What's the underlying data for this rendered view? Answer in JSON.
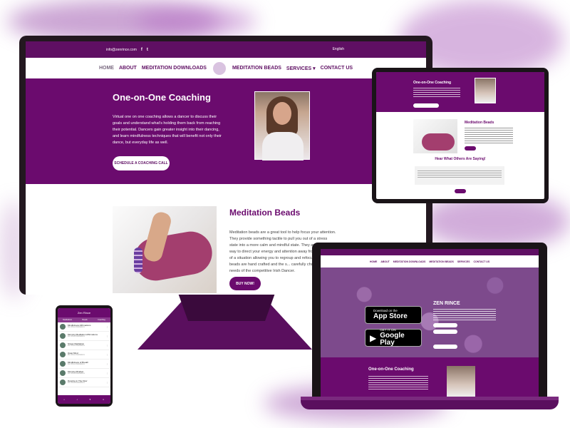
{
  "desktop": {
    "topbar": {
      "email": "info@zenrince.com",
      "social": [
        "f",
        "t"
      ],
      "language": "English"
    },
    "nav": [
      "HOME",
      "ABOUT",
      "MEDITATION DOWNLOADS",
      "MEDITATION BEADS",
      "SERVICES",
      "CONTACT US"
    ],
    "hero": {
      "title": "One-on-One Coaching",
      "text": "Virtual one on one coaching allows a dancer to discuss their goals and understand what's holding them back from reaching their potential. Dancers gain greater insight into their dancing, and learn mindfulness techniques that will benefit not only their dance, but everyday life as well.",
      "button": "SCHEDULE A COACHING CALL"
    },
    "beads": {
      "title": "Meditation Beads",
      "text": "Meditation beads are a great tool to help focus your attention. They provide something tactile to pull you out of a stress state into a more calm and mindful state.  They are a physical way to direct your energy and attention away from the stress of a situation allowing you to regroup and refocus. These beads are hand crafted and the s... carefully chosen for the needs of the competitive Irish Dancer.",
      "button": "BUY NOW!"
    }
  },
  "tablet": {
    "hero_title": "One-on-One Coaching",
    "beads_title": "Meditation Beads",
    "testimonials_title": "Hear What Others Are Saying!"
  },
  "laptop": {
    "nav": [
      "HOME",
      "ABOUT",
      "MEDITATION DOWNLOADS",
      "MEDITATION BEADS",
      "SERVICES",
      "CONTACT US"
    ],
    "app_store": {
      "small": "Download on the",
      "big": "App Store"
    },
    "google_play": {
      "small": "GET IT ON",
      "big": "Google Play"
    },
    "hero_title": "ZEN RINCE",
    "coaching_title": "One-on-One Coaching"
  },
  "phone": {
    "header": "Zen Rince",
    "tabs": [
      "Meditations",
      "Beads",
      "Coaching"
    ],
    "items": [
      {
        "title": "Mindfulness Affirmations",
        "sub": "Zen Rince Meditations"
      },
      {
        "title": "Morning Meditation Affirmations",
        "sub": "Zen Rince Meditations"
      },
      {
        "title": "Stress Meditation",
        "sub": "Zen Rince Meditations"
      },
      {
        "title": "Quiet Mind",
        "sub": "Zen Rince Meditations"
      },
      {
        "title": "Mindfulness of Breath",
        "sub": "Zen Rince Meditations"
      },
      {
        "title": "Morning Mindset",
        "sub": "Zen Rince Meditations"
      },
      {
        "title": "Dancing in The Flow",
        "sub": "Zen Rince Meditations"
      }
    ]
  },
  "colors": {
    "brand": "#6b0b6e",
    "accent": "#5f0f63",
    "background": "#ffffff"
  }
}
